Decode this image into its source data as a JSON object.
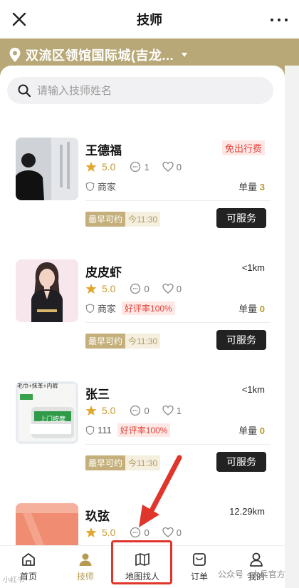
{
  "header": {
    "title": "技师"
  },
  "location": {
    "text": "双流区领馆国际城(吉龙..."
  },
  "search": {
    "placeholder": "请输入技师姓名"
  },
  "accent": "#b9a877",
  "technicians": [
    {
      "name": "王德福",
      "right_tag": "免出行费",
      "rating": "5.0",
      "comments": "1",
      "likes": "0",
      "type": "商家",
      "good_rate": "",
      "orders_label": "单量",
      "orders": "3",
      "earliest_label": "最早可约",
      "earliest_time": "今11:30",
      "button": "可服务"
    },
    {
      "name": "皮皮虾",
      "right_tag": "<1km",
      "rating": "5.0",
      "comments": "0",
      "likes": "0",
      "type": "商家",
      "good_rate": "好评率100%",
      "orders_label": "单量",
      "orders": "0",
      "earliest_label": "最早可约",
      "earliest_time": "今11:30",
      "button": "可服务"
    },
    {
      "name": "张三",
      "right_tag": "<1km",
      "rating": "5.0",
      "comments": "0",
      "likes": "1",
      "type": "111",
      "good_rate": "好评率100%",
      "orders_label": "单量",
      "orders": "0",
      "earliest_label": "最早可约",
      "earliest_time": "今11:30",
      "button": "可服务"
    },
    {
      "name": "玖弦",
      "right_tag": "12.29km",
      "rating": "5.0",
      "comments": "0",
      "likes": "0"
    }
  ],
  "product_text": {
    "line1": "毛巾+抹革+内裤",
    "line2": "上门按摩"
  },
  "tabs": [
    {
      "label": "首页",
      "icon": "home-icon"
    },
    {
      "label": "技师",
      "icon": "technician-icon"
    },
    {
      "label": "地图找人",
      "icon": "map-icon"
    },
    {
      "label": "订单",
      "icon": "order-icon"
    },
    {
      "label": "我的",
      "icon": "profile-icon"
    }
  ],
  "watermarks": {
    "left": "小红书",
    "right": "公众号 · 太兵官方"
  }
}
